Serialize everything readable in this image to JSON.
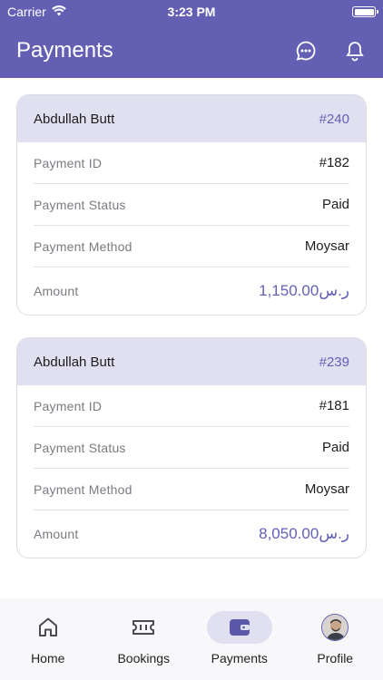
{
  "status_bar": {
    "carrier": "Carrier",
    "time": "3:23 PM"
  },
  "header": {
    "title": "Payments",
    "icons": [
      "chat-icon",
      "bell-icon"
    ]
  },
  "payments": [
    {
      "name": "Abdullah Butt",
      "ref": "#240",
      "rows": [
        {
          "label": "Payment ID",
          "value": "#182"
        },
        {
          "label": "Payment Status",
          "value": "Paid"
        },
        {
          "label": "Payment Method",
          "value": "Moysar"
        },
        {
          "label": "Amount",
          "value": "ر.س1,150.00"
        }
      ]
    },
    {
      "name": "Abdullah Butt",
      "ref": "#239",
      "rows": [
        {
          "label": "Payment ID",
          "value": "#181"
        },
        {
          "label": "Payment Status",
          "value": "Paid"
        },
        {
          "label": "Payment Method",
          "value": "Moysar"
        },
        {
          "label": "Amount",
          "value": "ر.س8,050.00"
        }
      ]
    }
  ],
  "tabs": [
    {
      "label": "Home",
      "icon": "home-icon"
    },
    {
      "label": "Bookings",
      "icon": "ticket-icon"
    },
    {
      "label": "Payments",
      "icon": "wallet-icon",
      "active": true
    },
    {
      "label": "Profile",
      "icon": "avatar"
    }
  ],
  "colors": {
    "primary": "#6360b4",
    "card_header": "#e1e0f1"
  }
}
